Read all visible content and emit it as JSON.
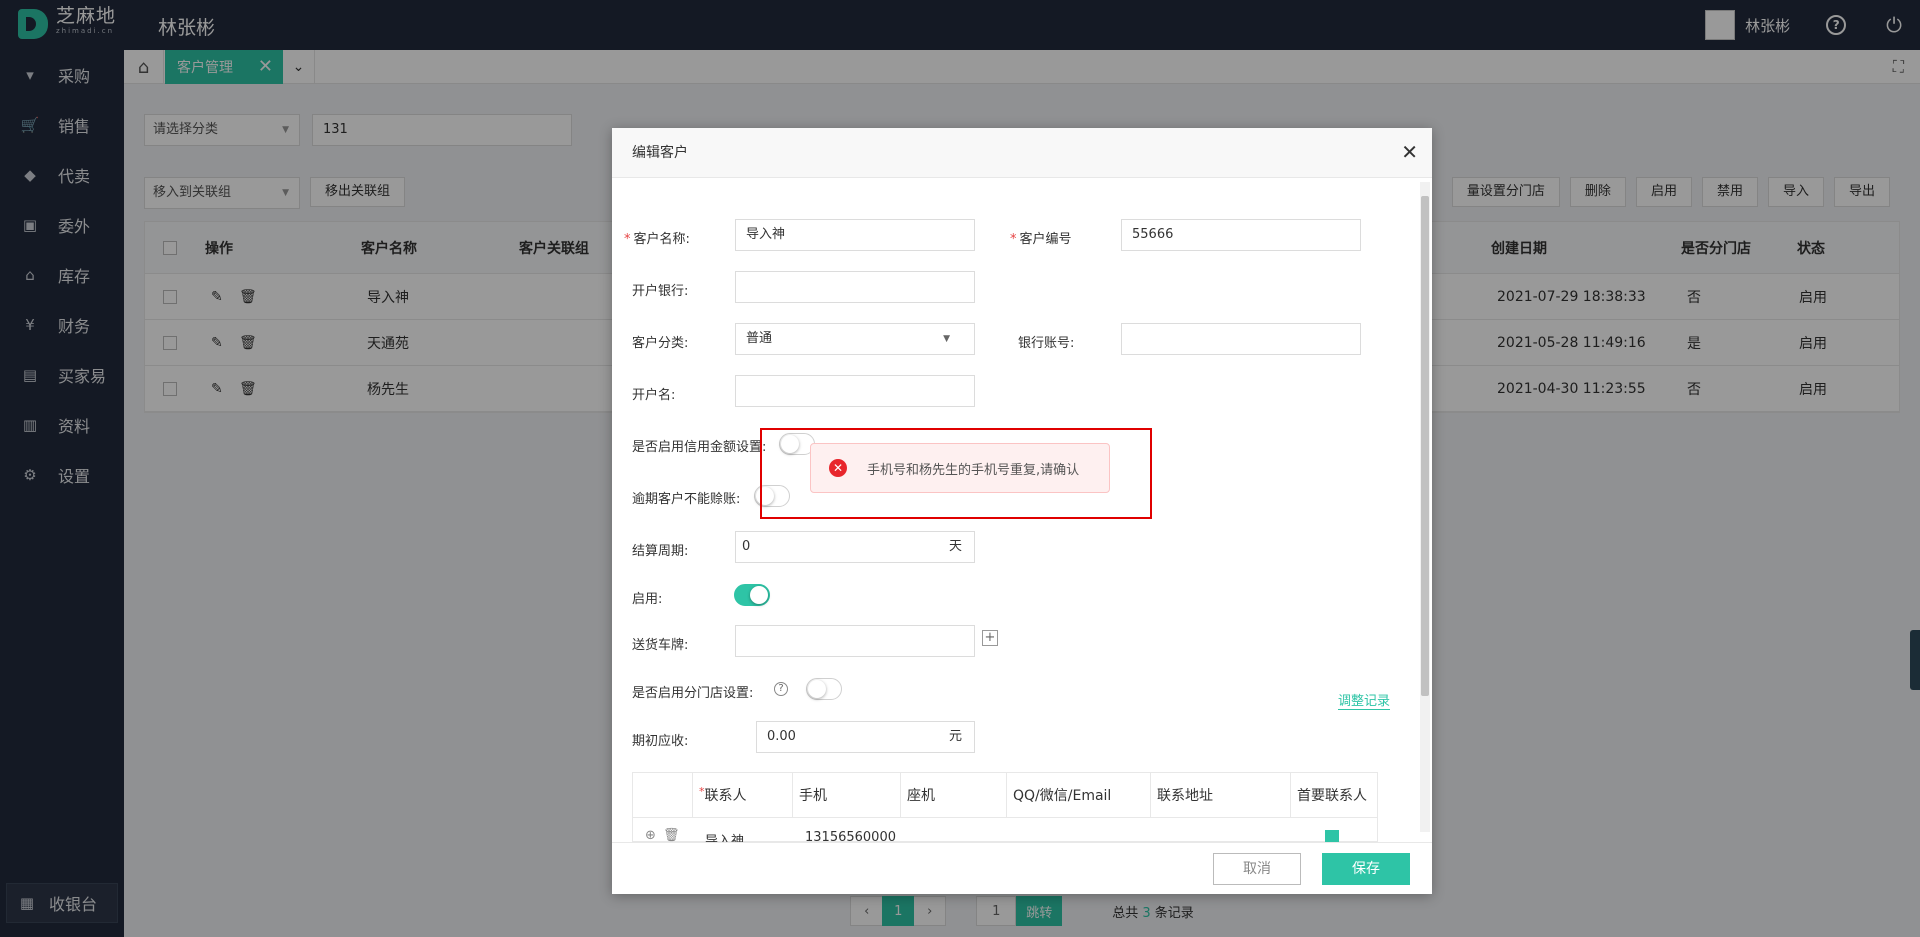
{
  "header": {
    "logo_cn": "芝麻地",
    "logo_en": "zhimadi.cn",
    "app_title": "林张彬",
    "user_name": "林张彬"
  },
  "sidebar": {
    "items": [
      {
        "label": "采购",
        "icon": "basket-icon"
      },
      {
        "label": "销售",
        "icon": "cart-icon"
      },
      {
        "label": "代卖",
        "icon": "tag-icon"
      },
      {
        "label": "委外",
        "icon": "handshake-icon"
      },
      {
        "label": "库存",
        "icon": "warehouse-icon"
      },
      {
        "label": "财务",
        "icon": "money-icon"
      },
      {
        "label": "买家易",
        "icon": "store-icon"
      },
      {
        "label": "资料",
        "icon": "printer-icon"
      },
      {
        "label": "设置",
        "icon": "gear-icon"
      }
    ],
    "cashier": "收银台"
  },
  "tabs": {
    "active": "客户管理"
  },
  "filters": {
    "category_placeholder": "请选择分类",
    "search_value": "131"
  },
  "toolbar": {
    "move_to_group": "移入到关联组",
    "move_out_group": "移出关联组",
    "right_buttons": [
      "量设置分门店",
      "删除",
      "启用",
      "禁用",
      "导入",
      "导出"
    ]
  },
  "table": {
    "headers": {
      "action": "操作",
      "name": "客户名称",
      "group": "客户关联组",
      "created": "创建日期",
      "branch": "是否分门店",
      "status": "状态"
    },
    "rows": [
      {
        "name": "导入神",
        "created": "2021-07-29 18:38:33",
        "branch": "否",
        "status": "启用"
      },
      {
        "name": "天通苑",
        "created": "2021-05-28 11:49:16",
        "branch": "是",
        "status": "启用"
      },
      {
        "name": "杨先生",
        "created": "2021-04-30 11:23:55",
        "branch": "否",
        "status": "启用"
      }
    ]
  },
  "pager": {
    "current": "1",
    "jump_value": "1",
    "jump_label": "跳转",
    "total_prefix": "总共",
    "total_count": "3",
    "total_suffix": "条记录"
  },
  "modal": {
    "title": "编辑客户",
    "fields": {
      "customer_name_label": "客户名称:",
      "customer_name_value": "导入神",
      "customer_no_label": "客户编号",
      "customer_no_value": "55666",
      "bank_label": "开户银行:",
      "category_label": "客户分类:",
      "category_value": "普通",
      "bank_account_label": "银行账号:",
      "account_name_label": "开户名:",
      "credit_label": "是否启用信用金额设置:",
      "overdue_label": "逾期客户不能赊账:",
      "settle_label": "结算周期:",
      "settle_value": "0",
      "settle_unit": "天",
      "enable_label": "启用:",
      "plate_label": "送货车牌:",
      "branch_label": "是否启用分门店设置:",
      "adjust_link": "调整记录",
      "initial_label": "期初应收:",
      "initial_value": "0.00",
      "initial_unit": "元"
    },
    "contacts_headers": [
      "联系人",
      "手机",
      "座机",
      "QQ/微信/Email",
      "联系地址",
      "首要联系人"
    ],
    "contact_row": {
      "name": "导入神",
      "phone": "13156560000"
    },
    "cancel": "取消",
    "save": "保存"
  },
  "toast": {
    "message": "手机号和杨先生的手机号重复,请确认"
  }
}
